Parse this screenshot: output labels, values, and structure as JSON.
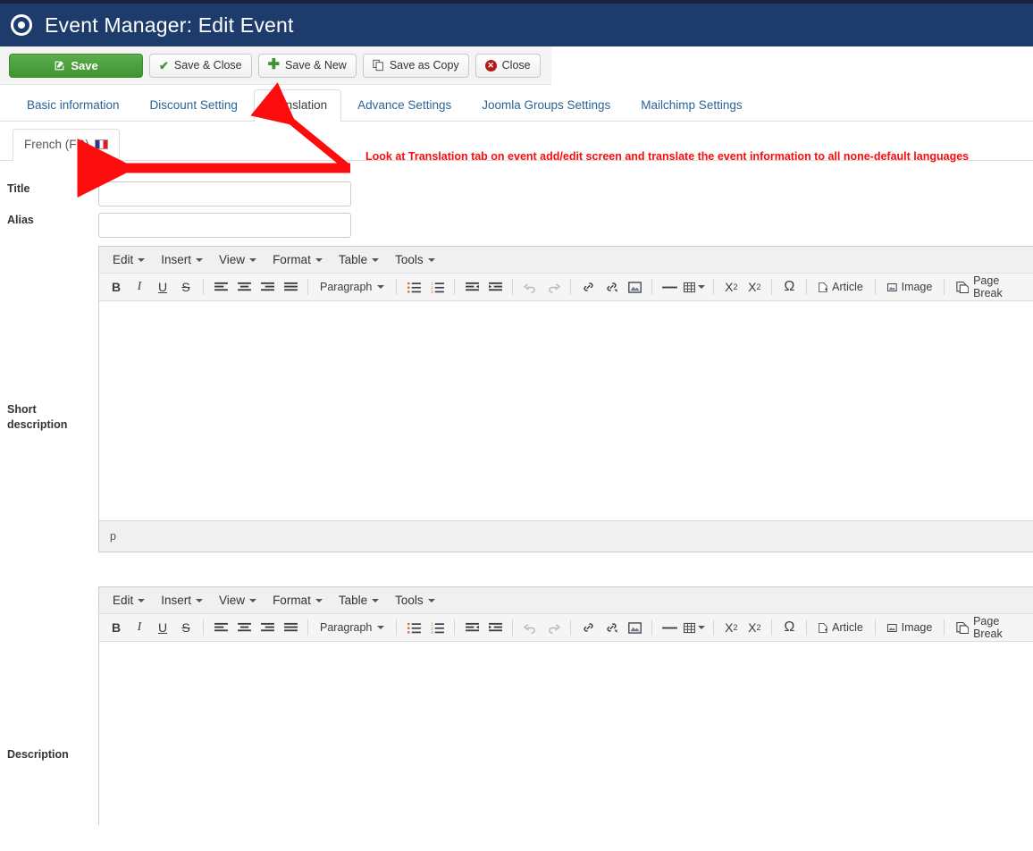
{
  "header": {
    "title": "Event Manager: Edit Event",
    "icon": "record-circle-icon"
  },
  "toolbar": {
    "buttons": [
      {
        "label": "Save",
        "icon": "pencil-square-icon",
        "style": "primary"
      },
      {
        "label": "Save & Close",
        "icon": "check-icon",
        "style": "default"
      },
      {
        "label": "Save & New",
        "icon": "plus-icon",
        "style": "default"
      },
      {
        "label": "Save as Copy",
        "icon": "copy-icon",
        "style": "default"
      },
      {
        "label": "Close",
        "icon": "close-circle-icon",
        "style": "default"
      }
    ]
  },
  "tabs": [
    {
      "label": "Basic information",
      "active": false
    },
    {
      "label": "Discount Setting",
      "active": false
    },
    {
      "label": "Translation",
      "active": true
    },
    {
      "label": "Advance Settings",
      "active": false
    },
    {
      "label": "Joomla Groups Settings",
      "active": false
    },
    {
      "label": "Mailchimp Settings",
      "active": false
    }
  ],
  "language_tabs": [
    {
      "label": "French (FR)",
      "flag": "flag-fr-icon",
      "active": true
    }
  ],
  "annotation": {
    "text": "Look at Translation tab on event add/edit screen and translate the event information to all none-default languages",
    "color": "#fc0c0c"
  },
  "form": {
    "title": {
      "label": "Title",
      "value": "",
      "placeholder": ""
    },
    "alias": {
      "label": "Alias",
      "value": "",
      "placeholder": ""
    },
    "short_description": {
      "label": "Short description"
    },
    "description": {
      "label": "Description"
    }
  },
  "editor": {
    "menus": [
      "Edit",
      "Insert",
      "View",
      "Format",
      "Table",
      "Tools"
    ],
    "format_select": "Paragraph",
    "buttons": [
      {
        "name": "bold",
        "glyph": "B"
      },
      {
        "name": "italic",
        "glyph": "I"
      },
      {
        "name": "underline",
        "glyph": "U"
      },
      {
        "name": "strikethrough",
        "glyph": "S"
      },
      {
        "name": "align-left",
        "glyph": ""
      },
      {
        "name": "align-center",
        "glyph": ""
      },
      {
        "name": "align-right",
        "glyph": ""
      },
      {
        "name": "align-justify",
        "glyph": ""
      },
      {
        "name": "bullist",
        "glyph": ""
      },
      {
        "name": "numlist",
        "glyph": ""
      },
      {
        "name": "outdent",
        "glyph": ""
      },
      {
        "name": "indent",
        "glyph": ""
      },
      {
        "name": "undo",
        "glyph": ""
      },
      {
        "name": "redo",
        "glyph": ""
      },
      {
        "name": "link",
        "glyph": ""
      },
      {
        "name": "unlink",
        "glyph": ""
      },
      {
        "name": "image",
        "glyph": ""
      },
      {
        "name": "hr",
        "glyph": ""
      },
      {
        "name": "table",
        "glyph": ""
      },
      {
        "name": "subscript",
        "glyph": ""
      },
      {
        "name": "superscript",
        "glyph": ""
      },
      {
        "name": "charmap",
        "glyph": "Ω"
      }
    ],
    "extra_buttons": [
      {
        "label": "Article",
        "icon": "article-icon"
      },
      {
        "label": "Image",
        "icon": "image-icon"
      },
      {
        "label": "Page Break",
        "icon": "page-break-icon"
      }
    ],
    "statusbar_path": "p",
    "content": ""
  }
}
